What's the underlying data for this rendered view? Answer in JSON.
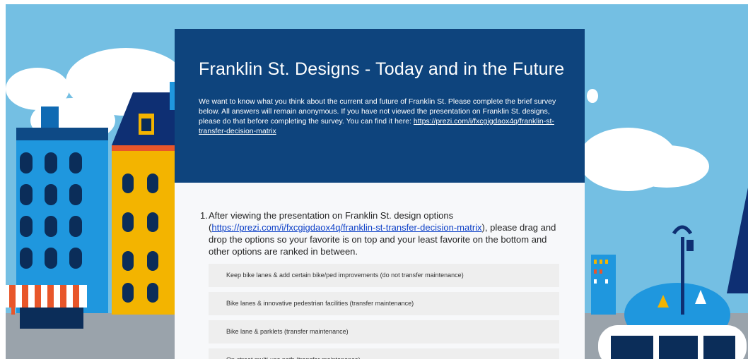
{
  "form": {
    "title": "Franklin St. Designs - Today and in the Future",
    "description_text": "We want to know what you think about the current and future of Franklin St. Please complete the brief survey below. All answers will remain anonymous. If you have not viewed the presentation on Franklin St. designs, please do that before completing the survey. You can find it here: ",
    "description_link": "https://prezi.com/i/fxcgigdaox4q/franklin-st-transfer-decision-matrix"
  },
  "question": {
    "number": "1.",
    "text_before": "After viewing the presentation on Franklin St. design options (",
    "link": "https://prezi.com/i/fxcgigdaox4q/franklin-st-transfer-decision-matrix",
    "text_after": "), please drag and drop the options so your favorite is on top and your least favorite on the bottom and other options are ranked in between."
  },
  "options": [
    "Keep bike lanes & add certain bike/ped improvements (do not transfer maintenance)",
    "Bike lanes & innovative pedestrian facilities (transfer maintenance)",
    "Bike lane & parklets (transfer maintenance)",
    "On-street multi-use path (transfer maintenance)"
  ],
  "colors": {
    "header_bg": "#0e447d",
    "sky": "#74bfe3",
    "link": "#0c3fc7"
  }
}
